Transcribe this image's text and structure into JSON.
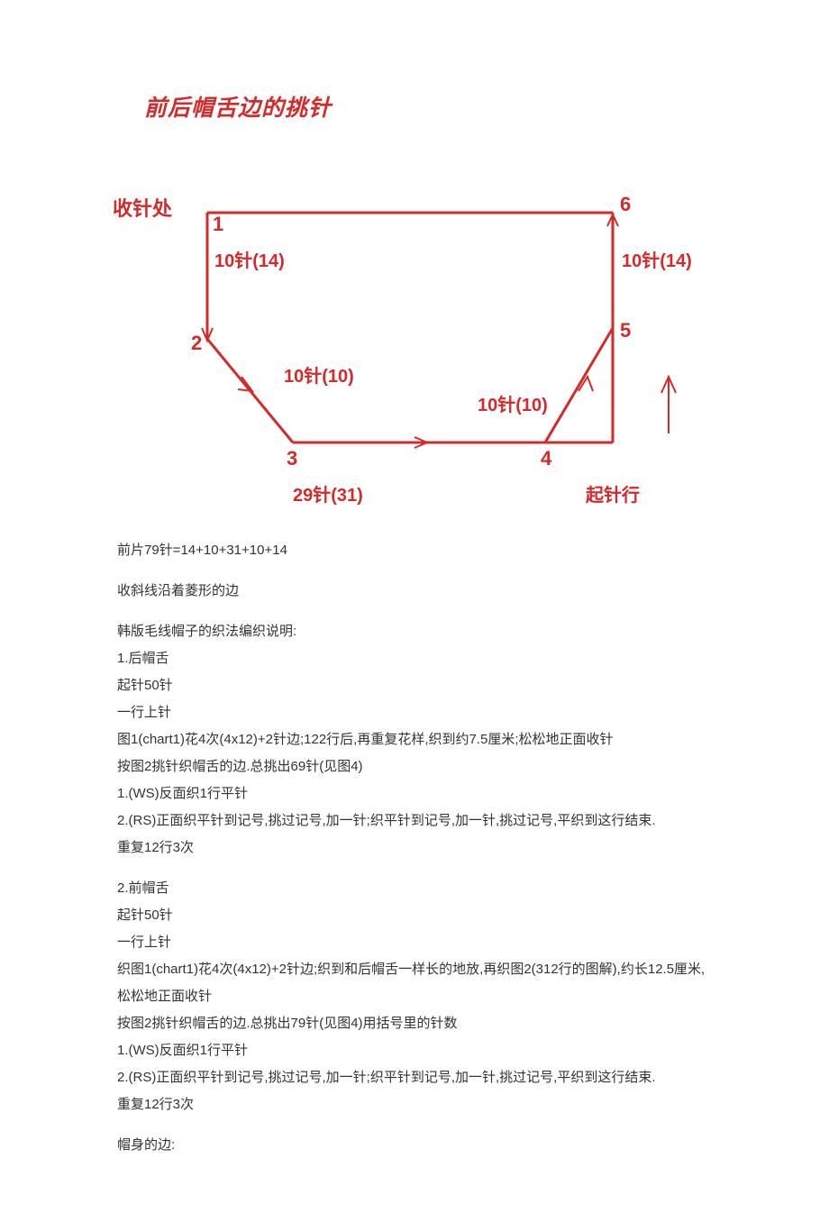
{
  "title": "前后帽舌边的挑针",
  "diagram": {
    "bind_off_label": "收针处",
    "cast_on_label": "起针行",
    "num1": "1",
    "num2": "2",
    "num3": "3",
    "num4": "4",
    "num5": "5",
    "num6": "6",
    "left_side": "10针(14)",
    "left_diag": "10针(10)",
    "bottom": "29针(31)",
    "right_diag": "10针(10)",
    "right_side": "10针(14)"
  },
  "text": {
    "p1": "前片79针=14+10+31+10+14",
    "p2": "收斜线沿着菱形的边",
    "p3a": "韩版毛线帽子的织法编织说明:",
    "p3b": "1.后帽舌",
    "p3c": "起针50针",
    "p3d": "一行上针",
    "p3e": "图1(chart1)花4次(4x12)+2针边;122行后,再重复花样,织到约7.5厘米;松松地正面收针",
    "p3f": "按图2挑针织帽舌的边.总挑出69针(见图4)",
    "p3g": "1.(WS)反面织1行平针",
    "p3h": "2.(RS)正面织平针到记号,挑过记号,加一针;织平针到记号,加一针,挑过记号,平织到这行结束.",
    "p3i": "重复12行3次",
    "p4a": "2.前帽舌",
    "p4b": "起针50针",
    "p4c": "一行上针",
    "p4d": "织图1(chart1)花4次(4x12)+2针边;织到和后帽舌一样长的地放,再织图2(312行的图解),约长12.5厘米,松松地正面收针",
    "p4e": "按图2挑针织帽舌的边.总挑出79针(见图4)用括号里的针数",
    "p4f": "1.(WS)反面织1行平针",
    "p4g": "2.(RS)正面织平针到记号,挑过记号,加一针;织平针到记号,加一针,挑过记号,平织到这行结束.",
    "p4h": "重复12行3次",
    "p5": "帽身的边:"
  }
}
